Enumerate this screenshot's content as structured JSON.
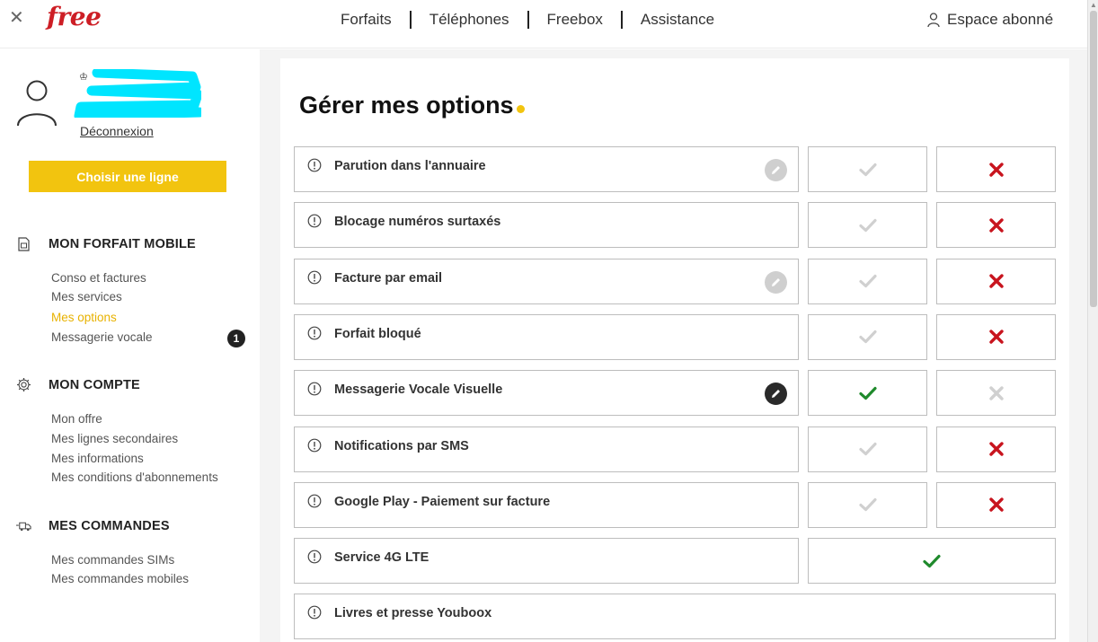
{
  "header": {
    "logo": "free",
    "nav": [
      "Forfaits",
      "Téléphones",
      "Freebox",
      "Assistance"
    ],
    "account": "Espace abonné"
  },
  "sidebar": {
    "logout": "Déconnexion",
    "choose_line": "Choisir une ligne",
    "sections": [
      {
        "title": "MON FORFAIT MOBILE",
        "icon": "sim-card-icon",
        "items": [
          "Conso et factures",
          "Mes services",
          "Mes options",
          "Messagerie vocale"
        ]
      },
      {
        "title": "MON COMPTE",
        "icon": "gear-icon",
        "items": [
          "Mon offre",
          "Mes lignes secondaires",
          "Mes informations",
          "Mes conditions d'abonnements"
        ]
      },
      {
        "title": "MES COMMANDES",
        "icon": "delivery-truck-icon",
        "items": [
          "Mes commandes SIMs",
          "Mes commandes mobiles"
        ]
      }
    ],
    "active_item": "Mes options",
    "voicemail_badge": "1"
  },
  "main": {
    "title_light": "Gérer mes ",
    "title_bold": "options",
    "options": [
      {
        "label": "Parution dans l'annuaire",
        "pencil": "grey",
        "state": "off"
      },
      {
        "label": "Blocage numéros surtaxés",
        "pencil": "none",
        "state": "off"
      },
      {
        "label": "Facture par email",
        "pencil": "grey",
        "state": "off"
      },
      {
        "label": "Forfait bloqué",
        "pencil": "none",
        "state": "off"
      },
      {
        "label": "Messagerie Vocale Visuelle",
        "pencil": "dark",
        "state": "on"
      },
      {
        "label": "Notifications par SMS",
        "pencil": "none",
        "state": "off"
      },
      {
        "label": "Google Play - Paiement sur facture",
        "pencil": "none",
        "state": "off"
      },
      {
        "label": "Service 4G LTE",
        "pencil": "none",
        "state": "always-on"
      },
      {
        "label": "Livres et presse Youboox",
        "pencil": "none",
        "state": "none"
      }
    ]
  },
  "colors": {
    "brand_red": "#cd1e25",
    "accent_yellow": "#f2c40f",
    "check_green": "#1f8a2c",
    "cross_red": "#c8141e",
    "inactive_grey": "#d0d0d0"
  }
}
